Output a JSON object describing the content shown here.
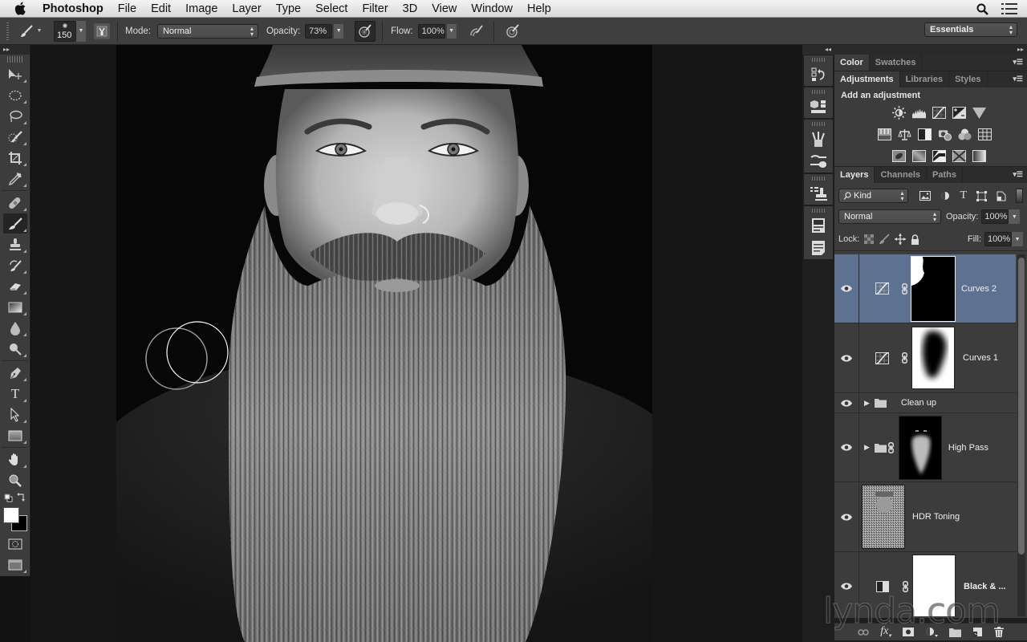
{
  "menubar": {
    "app_name": "Photoshop",
    "items": [
      "File",
      "Edit",
      "Image",
      "Layer",
      "Type",
      "Select",
      "Filter",
      "3D",
      "View",
      "Window",
      "Help"
    ],
    "right_icons": [
      "spotlight-search-icon",
      "notification-list-icon"
    ]
  },
  "options_bar": {
    "brush_size": "150",
    "mode_label": "Mode:",
    "mode_value": "Normal",
    "opacity_label": "Opacity:",
    "opacity_value": "73%",
    "flow_label": "Flow:",
    "flow_value": "100%",
    "workspace": "Essentials"
  },
  "toolbox": {
    "tools": [
      {
        "name": "move-tool",
        "active": false
      },
      {
        "name": "elliptical-marquee-tool",
        "active": false
      },
      {
        "name": "lasso-tool",
        "active": false
      },
      {
        "name": "quick-selection-tool",
        "active": false
      },
      {
        "name": "crop-tool",
        "active": false
      },
      {
        "name": "eyedropper-tool",
        "active": false
      },
      {
        "name": "healing-brush-tool",
        "active": false
      },
      {
        "name": "brush-tool",
        "active": true
      },
      {
        "name": "clone-stamp-tool",
        "active": false
      },
      {
        "name": "history-brush-tool",
        "active": false
      },
      {
        "name": "eraser-tool",
        "active": false
      },
      {
        "name": "gradient-tool",
        "active": false
      },
      {
        "name": "blur-tool",
        "active": false
      },
      {
        "name": "dodge-tool",
        "active": false
      },
      {
        "name": "pen-tool",
        "active": false
      },
      {
        "name": "type-tool",
        "active": false
      },
      {
        "name": "path-selection-tool",
        "active": false
      },
      {
        "name": "rectangle-tool",
        "active": false
      },
      {
        "name": "hand-tool",
        "active": false
      },
      {
        "name": "zoom-tool",
        "active": false
      }
    ],
    "foreground_color": "#ffffff",
    "background_color": "#000000"
  },
  "panels": {
    "color_group": {
      "tabs": [
        "Color",
        "Swatches"
      ],
      "active": 0
    },
    "adjust_group": {
      "tabs": [
        "Adjustments",
        "Libraries",
        "Styles"
      ],
      "active": 0,
      "title": "Add an adjustment",
      "row1": [
        "brightness-contrast",
        "levels",
        "curves",
        "exposure",
        "vibrance"
      ],
      "row2": [
        "hue-saturation",
        "color-balance",
        "black-white",
        "photo-filter",
        "channel-mixer",
        "color-lookup"
      ],
      "row3": [
        "invert",
        "posterize",
        "threshold",
        "selective-color",
        "gradient-map"
      ]
    },
    "layers_group": {
      "tabs": [
        "Layers",
        "Channels",
        "Paths"
      ],
      "active": 0,
      "filter_kind": "Kind",
      "blend_mode": "Normal",
      "opacity_label": "Opacity:",
      "opacity_value": "100%",
      "lock_label": "Lock:",
      "fill_label": "Fill:",
      "fill_value": "100%",
      "layers": [
        {
          "name": "Curves 2",
          "type": "curves-adjustment",
          "visible": true,
          "selected": true
        },
        {
          "name": "Curves 1",
          "type": "curves-adjustment",
          "visible": true,
          "selected": false
        },
        {
          "name": "Clean up",
          "type": "group",
          "visible": true,
          "selected": false
        },
        {
          "name": "High Pass",
          "type": "group-with-mask",
          "visible": true,
          "selected": false
        },
        {
          "name": "HDR Toning",
          "type": "pixel",
          "visible": true,
          "selected": false
        },
        {
          "name": "Black & ...",
          "type": "black-white-adjustment",
          "visible": true,
          "selected": false
        }
      ]
    }
  },
  "watermark": "lynda.com",
  "colors": {
    "selected_layer": "#5d7291",
    "panel_bg": "#3c3c3c",
    "app_bg": "#161616"
  }
}
